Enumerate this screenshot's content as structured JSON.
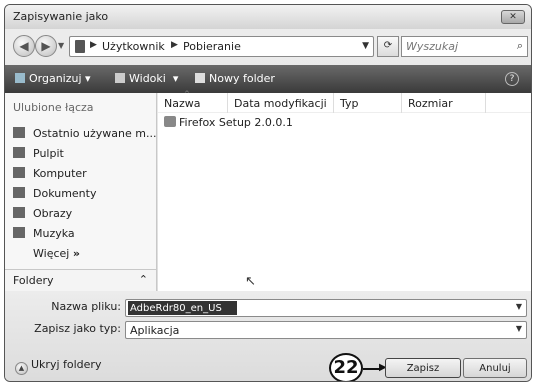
{
  "window": {
    "title": "Zapisywanie jako",
    "close_glyph": "✕"
  },
  "nav": {
    "breadcrumb": [
      "Użytkownik",
      "Pobieranie"
    ],
    "search_placeholder": "Wyszukaj"
  },
  "toolbar": {
    "organize": "Organizuj",
    "views": "Widoki",
    "new_folder": "Nowy folder"
  },
  "sidebar": {
    "header": "Ulubione łącza",
    "items": [
      {
        "label": "Ostatnio używane m...",
        "icon": "recent-icon"
      },
      {
        "label": "Pulpit",
        "icon": "desktop-icon"
      },
      {
        "label": "Komputer",
        "icon": "computer-icon"
      },
      {
        "label": "Dokumenty",
        "icon": "documents-icon"
      },
      {
        "label": "Obrazy",
        "icon": "pictures-icon"
      },
      {
        "label": "Muzyka",
        "icon": "music-icon"
      }
    ],
    "more": "Więcej",
    "folders": "Foldery"
  },
  "filelist": {
    "columns": [
      "Nazwa",
      "Data modyfikacji",
      "Typ",
      "Rozmiar"
    ],
    "files": [
      "Firefox Setup 2.0.0.1"
    ]
  },
  "form": {
    "filename_label": "Nazwa pliku:",
    "filename_value": "AdbeRdr80_en_US",
    "type_label": "Zapisz jako typ:",
    "type_value": "Aplikacja"
  },
  "footer": {
    "hide_folders": "Ukryj foldery",
    "save": "Zapisz",
    "cancel": "Anuluj",
    "callout": "22"
  }
}
